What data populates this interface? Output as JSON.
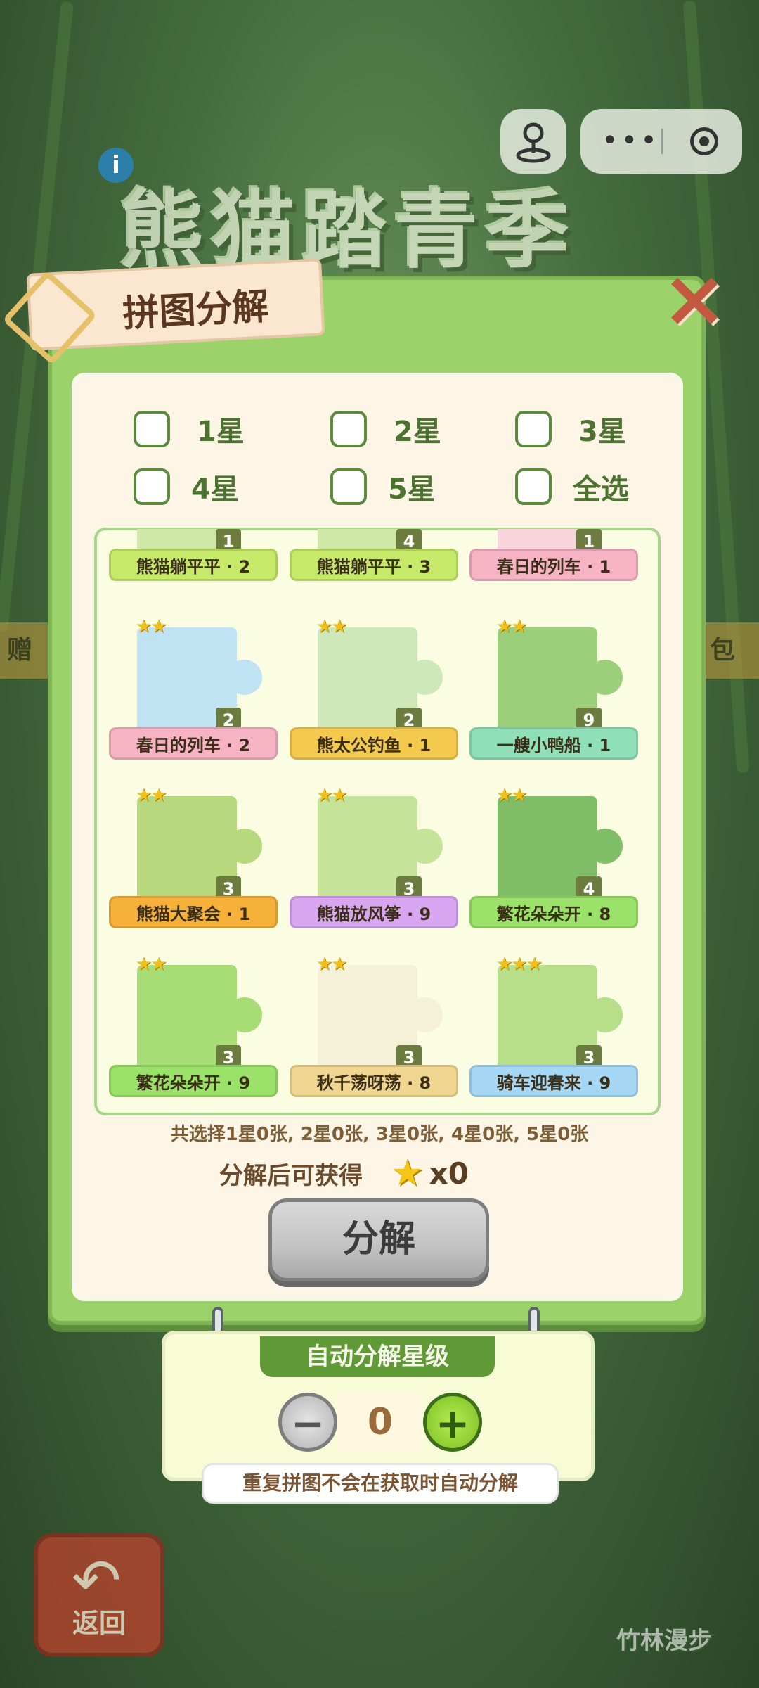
{
  "game_title": "熊猫踏青季",
  "info_icon": "i",
  "panel": {
    "title": "拼图分解",
    "close_icon": "×"
  },
  "filters": [
    {
      "label": "1星"
    },
    {
      "label": "2星"
    },
    {
      "label": "3星"
    },
    {
      "label": "4星"
    },
    {
      "label": "5星"
    },
    {
      "label": "全选"
    }
  ],
  "cards": [
    {
      "name": "熊猫躺平平 · 2",
      "count": "1",
      "stars": "",
      "ribbon_color": "#c7e96a",
      "pic_color": "#cfe8a7"
    },
    {
      "name": "熊猫躺平平 · 3",
      "count": "4",
      "stars": "",
      "ribbon_color": "#c7e96a",
      "pic_color": "#cfe8a7"
    },
    {
      "name": "春日的列车 · 1",
      "count": "1",
      "stars": "",
      "ribbon_color": "#f6b3c4",
      "pic_color": "#f7d5db"
    },
    {
      "name": "春日的列车 · 2",
      "count": "2",
      "stars": "★★",
      "ribbon_color": "#f6b3c4",
      "pic_color": "#bfe3f3"
    },
    {
      "name": "熊太公钓鱼 · 1",
      "count": "2",
      "stars": "★★",
      "ribbon_color": "#f3c94e",
      "pic_color": "#cfe8b9"
    },
    {
      "name": "一艘小鸭船 · 1",
      "count": "9",
      "stars": "★★",
      "ribbon_color": "#8fe0b8",
      "pic_color": "#9ccf79"
    },
    {
      "name": "熊猫大聚会 · 1",
      "count": "3",
      "stars": "★★",
      "ribbon_color": "#f6b13b",
      "pic_color": "#b8d87e"
    },
    {
      "name": "熊猫放风筝 · 9",
      "count": "3",
      "stars": "★★",
      "ribbon_color": "#d9a6f2",
      "pic_color": "#c6e39a"
    },
    {
      "name": "繁花朵朵开 · 8",
      "count": "4",
      "stars": "★★",
      "ribbon_color": "#9be26a",
      "pic_color": "#7fbd66"
    },
    {
      "name": "繁花朵朵开 · 9",
      "count": "3",
      "stars": "★★",
      "ribbon_color": "#9be26a",
      "pic_color": "#a8dc74"
    },
    {
      "name": "秋千荡呀荡 · 8",
      "count": "3",
      "stars": "★★",
      "ribbon_color": "#f0d691",
      "pic_color": "#f5f0d8"
    },
    {
      "name": "骑车迎春来 · 9",
      "count": "3",
      "stars": "★★★",
      "ribbon_color": "#a6d8f5",
      "pic_color": "#b7df8a"
    }
  ],
  "summary": "共选择1星0张, 2星0张, 3星0张, 4星0张, 5星0张",
  "reward": {
    "label": "分解后可获得",
    "value": "x0"
  },
  "decompose_button": "分解",
  "auto": {
    "title": "自动分解星级",
    "minus": "−",
    "plus": "+",
    "level": "0",
    "hint": "重复拼图不会在获取时自动分解"
  },
  "background": {
    "back_label": "返回",
    "back_icon": "↶",
    "bottom_right_label": "竹林漫步",
    "left_side_text": "赠",
    "right_side_text": "包"
  }
}
